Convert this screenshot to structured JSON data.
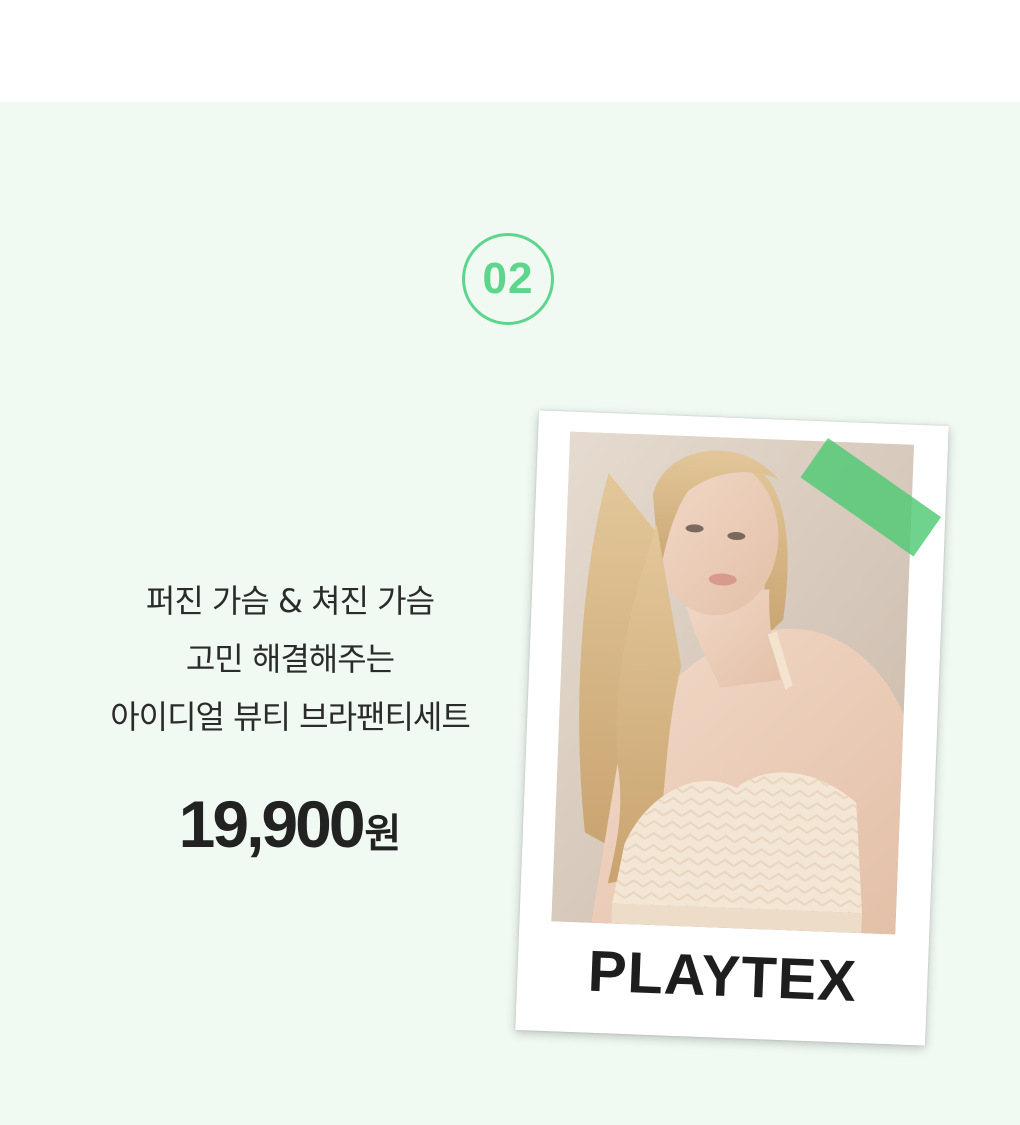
{
  "badge": {
    "number": "02"
  },
  "headline": {
    "lines": [
      "퍼진 가슴 & 쳐진 가슴",
      "고민 해결해주는",
      "아이디얼 뷰티 브라팬티세트"
    ]
  },
  "price": {
    "amount": "19,900",
    "unit": "원"
  },
  "card": {
    "brand": "PLAYTEX"
  },
  "colors": {
    "background": "#f0f9f2",
    "accent": "#5ed58d",
    "tape": "#4fc974"
  }
}
